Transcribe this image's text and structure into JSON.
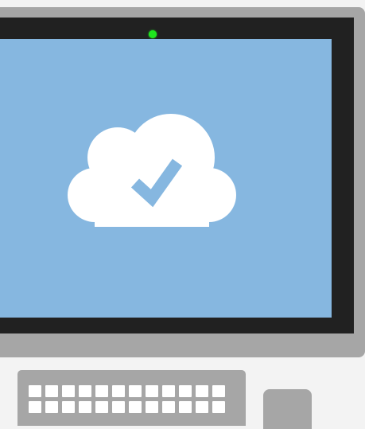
{
  "colors": {
    "background": "#f3f3f3",
    "monitor_frame": "#a6a6a6",
    "bezel": "#212121",
    "screen": "#86b7e0",
    "status_led": "#1ee61e",
    "cloud": "#ffffff",
    "checkmark": "#86b7e0",
    "keyboard": "#a6a6a6",
    "key": "#ffffff",
    "mouse": "#a6a6a6"
  },
  "icons": {
    "screen_icon": "cloud-check-icon",
    "status_indicator": "webcam-led"
  },
  "keyboard": {
    "key_columns": 12,
    "visible_key_rows": 2
  }
}
